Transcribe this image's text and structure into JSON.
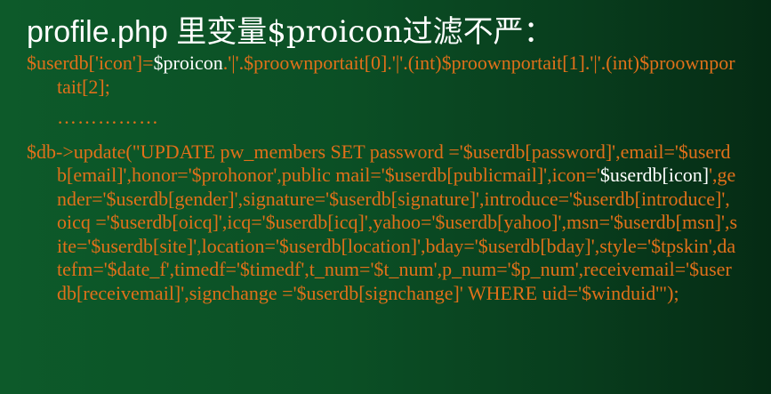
{
  "title": {
    "latin": "profile.php ",
    "cjk": "里变量$proicon过滤不严："
  },
  "line1": {
    "pre": "$userdb['icon']=",
    "hl": "$proicon",
    "post": ".'|'.$proownportait[0].'|'.(int)$proownportait[1].'|'.(int)$proownportait[2];"
  },
  "ellipsis": "……………",
  "sql": {
    "pre": "$db->update(\"UPDATE pw_members SET password ='$userdb[password]',email='$userdb[email]',honor='$prohonor',public mail='$userdb[publicmail]',icon='",
    "hl": "$userdb[icon]",
    "post": "',gender='$userdb[gender]',signature='$userdb[signature]',introduce='$userdb[introduce]',oicq ='$userdb[oicq]',icq='$userdb[icq]',yahoo='$userdb[yahoo]',msn='$userdb[msn]',site='$userdb[site]',location='$userdb[location]',bday='$userdb[bday]',style='$tpskin',datefm='$date_f',timedf='$timedf',t_num='$t_num',p_num='$p_num',receivemail='$userdb[receivemail]',signchange ='$userdb[signchange]' WHERE uid='$winduid'\");"
  }
}
